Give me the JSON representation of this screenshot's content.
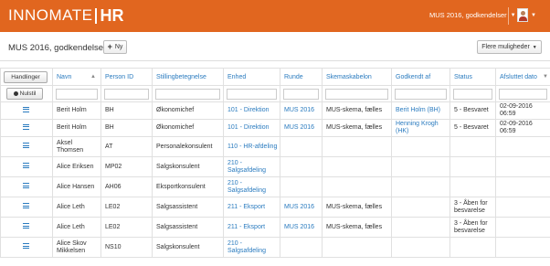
{
  "brand": {
    "logo_text": "INNOMATE",
    "logo_hr": "HR"
  },
  "header": {
    "user_context": "MUS 2016, godkendelser",
    "user_chevron": "v",
    "avatar_chevron": "v"
  },
  "page": {
    "title": "MUS 2016, godkendelser",
    "new_button": "Ny",
    "more_button": "Flere muligheder"
  },
  "table": {
    "actions_label": "Handlinger",
    "reset_label": "Nulstil",
    "columns": [
      "Navn",
      "Person ID",
      "Stillingbetegnelse",
      "Enhed",
      "Runde",
      "Skemaskabelon",
      "Godkendt af",
      "Status",
      "Afsluttet dato"
    ],
    "rows": [
      {
        "navn": "Berit Holm",
        "person_id": "BH",
        "stilling": "Økonomichef",
        "enhed": "101 - Direktion",
        "runde": "MUS 2016",
        "skema": "MUS-skema, fælles",
        "godkendt_af": "Berit Holm (BH)",
        "status": "5 - Besvaret",
        "afsluttet": "02-09-2016 06:59"
      },
      {
        "navn": "Berit Holm",
        "person_id": "BH",
        "stilling": "Økonomichef",
        "enhed": "101 - Direktion",
        "runde": "MUS 2016",
        "skema": "MUS-skema, fælles",
        "godkendt_af": "Henning Krogh (HK)",
        "status": "5 - Besvaret",
        "afsluttet": "02-09-2016 06:59"
      },
      {
        "navn": "Aksel Thomsen",
        "person_id": "AT",
        "stilling": "Personalekonsulent",
        "enhed": "110 - HR-afdeling",
        "runde": "",
        "skema": "",
        "godkendt_af": "",
        "status": "",
        "afsluttet": ""
      },
      {
        "navn": "Alice Eriksen",
        "person_id": "MP02",
        "stilling": "Salgskonsulent",
        "enhed": "210 - Salgsafdeling",
        "runde": "",
        "skema": "",
        "godkendt_af": "",
        "status": "",
        "afsluttet": ""
      },
      {
        "navn": "Alice Hansen",
        "person_id": "AH06",
        "stilling": "Eksportkonsulent",
        "enhed": "210 - Salgsafdeling",
        "runde": "",
        "skema": "",
        "godkendt_af": "",
        "status": "",
        "afsluttet": ""
      },
      {
        "navn": "Alice Leth",
        "person_id": "LE02",
        "stilling": "Salgsassistent",
        "enhed": "211 - Eksport",
        "runde": "MUS 2016",
        "skema": "MUS-skema, fælles",
        "godkendt_af": "",
        "status": "3 - Åben for besvarelse",
        "afsluttet": ""
      },
      {
        "navn": "Alice Leth",
        "person_id": "LE02",
        "stilling": "Salgsassistent",
        "enhed": "211 - Eksport",
        "runde": "MUS 2016",
        "skema": "MUS-skema, fælles",
        "godkendt_af": "",
        "status": "3 - Åben for besvarelse",
        "afsluttet": ""
      },
      {
        "navn": "Alice Skov Mikkelsen",
        "person_id": "NS10",
        "stilling": "Salgskonsulent",
        "enhed": "210 - Salgsafdeling",
        "runde": "",
        "skema": "",
        "godkendt_af": "",
        "status": "",
        "afsluttet": ""
      }
    ]
  },
  "colors": {
    "brand_orange": "#e1661f",
    "link_blue": "#2a7bbf"
  },
  "icons": {
    "new": "plus-icon",
    "row_action": "list-icon",
    "reset": "reset-icon"
  }
}
